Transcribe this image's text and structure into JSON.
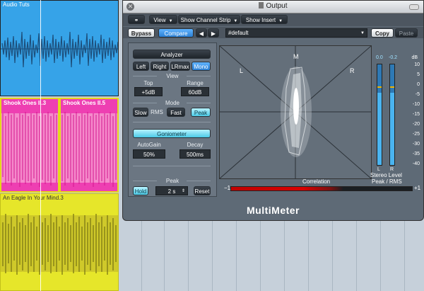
{
  "tracks": [
    {
      "title": "Audio Tuts"
    },
    {
      "title": "Shook Ones II.3"
    },
    {
      "title": "Shook Ones II.5"
    },
    {
      "title": "An Eagle In Your Mind.3"
    }
  ],
  "window": {
    "title": "Output"
  },
  "toolbar": {
    "view_label": "View",
    "show_channel_strip_label": "Show Channel Strip",
    "show_insert_label": "Show Insert",
    "bypass_label": "Bypass",
    "compare_label": "Compare",
    "prev_label": "◀",
    "next_label": "▶",
    "preset_value": "#default",
    "copy_label": "Copy",
    "paste_label": "Paste"
  },
  "panel": {
    "analyzer_label": "Analyzer",
    "channels": [
      "Left",
      "Right",
      "LRmax",
      "Mono"
    ],
    "view_label": "View",
    "top_label": "Top",
    "top_value": "+5dB",
    "range_label": "Range",
    "range_value": "60dB",
    "mode_label": "Mode",
    "slow_label": "Slow",
    "rms_label": "RMS",
    "fast_label": "Fast",
    "peak_mode_label": "Peak",
    "goniometer_label": "Goniometer",
    "autogain_label": "AutoGain",
    "autogain_value": "50%",
    "decay_label": "Decay",
    "decay_value": "500ms",
    "peak_section_label": "Peak",
    "hold_label": "Hold",
    "hold_value": "2 s",
    "reset_label": "Reset"
  },
  "display": {
    "label_m": "M",
    "label_l": "L",
    "label_r": "R"
  },
  "meters": {
    "peak_left": "0.0",
    "peak_right": "-0.2",
    "db_unit": "dB",
    "ticks": [
      "10",
      "5",
      "0",
      "-5",
      "-10",
      "-15",
      "-20",
      "-25",
      "-30",
      "-35",
      "-40"
    ],
    "label_l": "L",
    "label_r": "R",
    "stereo_level_label": "Stereo Level",
    "peak_rms_label": "Peak / RMS",
    "left_level": 0.72,
    "right_level": 0.72
  },
  "correlation": {
    "label": "Correlation",
    "min_label": "−1",
    "max_label": "+1"
  },
  "brand": "MultiMeter",
  "colors": {
    "accent": "#4ab4f0",
    "audio_clip": "#36a3e8",
    "shook_clip": "#ee3fb2",
    "eagle_clip": "#e6e62a"
  }
}
